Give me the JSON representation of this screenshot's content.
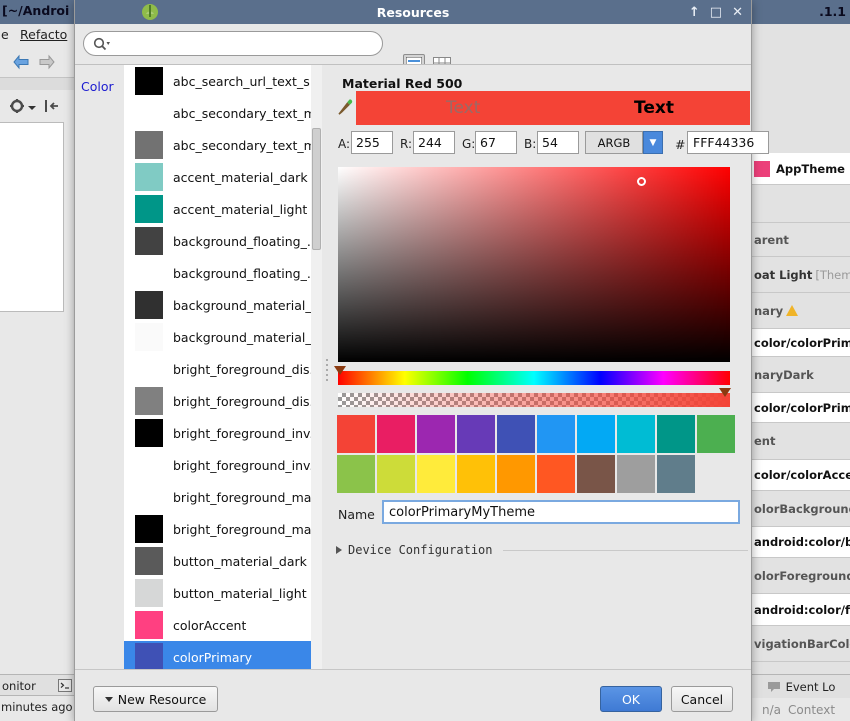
{
  "ide": {
    "window_title": "[~/Androi",
    "window_title_right": ".1.1",
    "menu": [
      {
        "label": "e",
        "x": 2
      },
      {
        "label": "Refacto",
        "x": 22
      }
    ],
    "status_monitor": "onitor",
    "status_time": "minutes ago",
    "theme_panel": [
      {
        "type": "white_swatch",
        "label": "AppTheme"
      },
      {
        "type": "grey",
        "label": ""
      },
      {
        "type": "plain",
        "label": "arent"
      },
      {
        "type": "grey_note",
        "label": "oat Light",
        "note": "[Theme."
      },
      {
        "type": "plain_warn",
        "label": "nary"
      },
      {
        "type": "white",
        "label": "color/colorPrima"
      },
      {
        "type": "plain",
        "label": "naryDark"
      },
      {
        "type": "white",
        "label": "color/colorPrima"
      },
      {
        "type": "plain",
        "label": "ent"
      },
      {
        "type": "white",
        "label": "color/colorAccen"
      },
      {
        "type": "plain",
        "label": "olorBackground"
      },
      {
        "type": "white",
        "label": "android:color/bac"
      },
      {
        "type": "plain",
        "label": "olorForeground"
      },
      {
        "type": "white",
        "label": "android:color/fore"
      },
      {
        "type": "plain",
        "label": "vigationBarColo"
      }
    ],
    "event_log": "Event Lo",
    "context_na": "n/a",
    "context_label": "Context"
  },
  "dialog": {
    "title": "Resources",
    "window_buttons": [
      "↑",
      "□",
      "✕"
    ],
    "search": {
      "value": "",
      "placeholder": ""
    },
    "view_buttons": [
      {
        "name": "list-view",
        "selected": true
      },
      {
        "name": "grid-view",
        "selected": false
      }
    ],
    "category": "Color",
    "resources": [
      {
        "label": "abc_search_url_text_s...",
        "color": "#000000",
        "has_chip": true
      },
      {
        "label": "abc_secondary_text_m...",
        "color": "",
        "has_chip": false
      },
      {
        "label": "abc_secondary_text_m...",
        "color": "#727272",
        "has_chip": true
      },
      {
        "label": "accent_material_dark",
        "color": "#80cbc4",
        "has_chip": true
      },
      {
        "label": "accent_material_light",
        "color": "#009688",
        "has_chip": true
      },
      {
        "label": "background_floating_...",
        "color": "#424242",
        "has_chip": true
      },
      {
        "label": "background_floating_...",
        "color": "",
        "has_chip": false
      },
      {
        "label": "background_material_...",
        "color": "#303030",
        "has_chip": true
      },
      {
        "label": "background_material_l...",
        "color": "#fafafa",
        "has_chip": true
      },
      {
        "label": "bright_foreground_dis...",
        "color": "",
        "has_chip": false
      },
      {
        "label": "bright_foreground_dis...",
        "color": "#808080",
        "has_chip": true
      },
      {
        "label": "bright_foreground_inv...",
        "color": "#000000",
        "has_chip": true
      },
      {
        "label": "bright_foreground_inv...",
        "color": "",
        "has_chip": false
      },
      {
        "label": "bright_foreground_ma...",
        "color": "",
        "has_chip": false
      },
      {
        "label": "bright_foreground_ma...",
        "color": "#000000",
        "has_chip": true
      },
      {
        "label": "button_material_dark",
        "color": "#5a5a5a",
        "has_chip": true
      },
      {
        "label": "button_material_light",
        "color": "#d6d7d7",
        "has_chip": true
      },
      {
        "label": "colorAccent",
        "color": "#ff4081",
        "has_chip": true
      },
      {
        "label": "colorPrimary",
        "color": "#3f51b5",
        "has_chip": true,
        "selected": true
      }
    ],
    "editor": {
      "color_title": "Material Red 500",
      "preview_text_left": "Text",
      "preview_text_right": "Text",
      "preview_color": "#f44336",
      "channels": [
        {
          "label": "A:",
          "value": "255"
        },
        {
          "label": "R:",
          "value": "244"
        },
        {
          "label": "G:",
          "value": "67"
        },
        {
          "label": "B:",
          "value": "54"
        }
      ],
      "mode": "ARGB",
      "hash_label": "#",
      "hex_value": "FFF44336",
      "palette_rows": [
        [
          "#f44336",
          "#e91e63",
          "#9c27b0",
          "#673ab7",
          "#3f51b5",
          "#2196f3",
          "#03a9f4",
          "#00bcd4",
          "#009688",
          "#4caf50"
        ],
        [
          "#8bc34a",
          "#cddc39",
          "#ffeb3b",
          "#ffc107",
          "#ff9800",
          "#ff5722",
          "#795548",
          "#9e9e9e",
          "#607d8b"
        ]
      ],
      "name_label": "Name",
      "name_value": "colorPrimaryMyTheme",
      "device_config_label": "Device Configuration"
    },
    "footer": {
      "new_resource": "New Resource",
      "ok": "OK",
      "cancel": "Cancel"
    }
  }
}
